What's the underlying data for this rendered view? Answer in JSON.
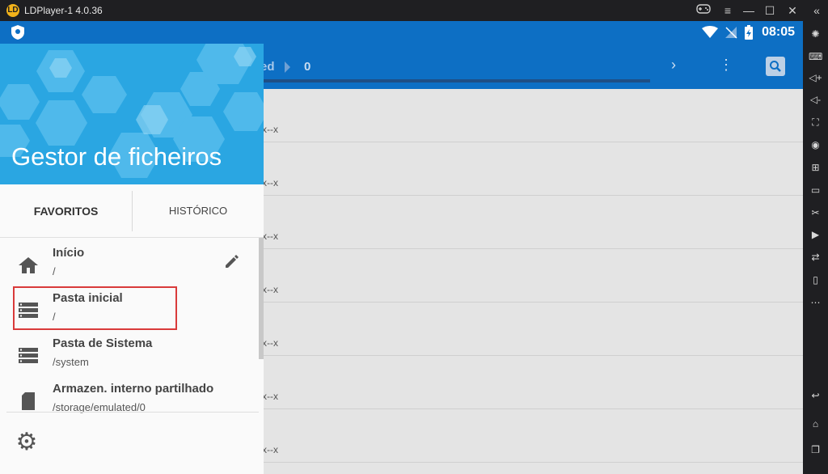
{
  "window": {
    "title": "LDPlayer-1 4.0.36",
    "buttons": [
      "gamepad-icon",
      "menu-icon",
      "minimize-icon",
      "maximize-icon",
      "close-icon",
      "collapse-icon"
    ]
  },
  "statusbar": {
    "time": "08:05"
  },
  "appbar": {
    "crumb": "ed",
    "count": "0"
  },
  "list_rows": [
    {
      "meta": "x--x"
    },
    {
      "meta": "x--x"
    },
    {
      "meta": "x--x"
    },
    {
      "meta": "x--x"
    },
    {
      "meta": "x--x"
    },
    {
      "meta": "x--x"
    },
    {
      "meta": "x--x"
    }
  ],
  "drawer": {
    "title": "Gestor de ficheiros",
    "tabs": {
      "favorites": "FAVORITOS",
      "history": "HISTÓRICO"
    },
    "items": [
      {
        "label": "Início",
        "path": "/",
        "icon": "home-icon"
      },
      {
        "label": "Pasta inicial",
        "path": "/",
        "icon": "storage-icon"
      },
      {
        "label": "Pasta de Sistema",
        "path": "/system",
        "icon": "storage-icon"
      },
      {
        "label": "Armazen. interno partilhado",
        "path": "/storage/emulated/0",
        "icon": "sd-card-icon"
      }
    ]
  },
  "colors": {
    "accent": "#0d6fc4",
    "drawer_header": "#2aa6e2",
    "highlight": "#d93a3a"
  }
}
